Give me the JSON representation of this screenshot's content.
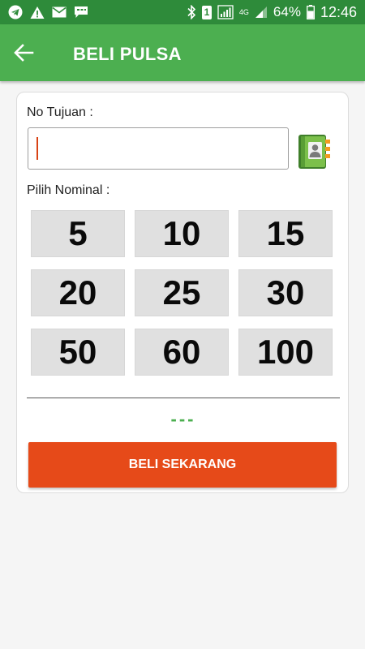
{
  "status_bar": {
    "battery": "64%",
    "time": "12:46",
    "network_label": "4G",
    "sim_slot": "1"
  },
  "app_bar": {
    "title": "BELI PULSA"
  },
  "form": {
    "phone_label": "No Tujuan :",
    "phone_value": "",
    "nominal_label": "Pilih Nominal :",
    "nominals": [
      "5",
      "10",
      "15",
      "20",
      "25",
      "30",
      "50",
      "60",
      "100"
    ],
    "price_display": "---",
    "buy_label": "BELI SEKARANG"
  },
  "icons": {
    "back": "arrow-left-icon",
    "contact": "address-book-icon"
  },
  "colors": {
    "statusbar": "#2e8b3a",
    "appbar": "#4caf50",
    "buy_button": "#e64a19",
    "price_text": "#4caf50",
    "nominal_button": "#e0e0e0"
  }
}
